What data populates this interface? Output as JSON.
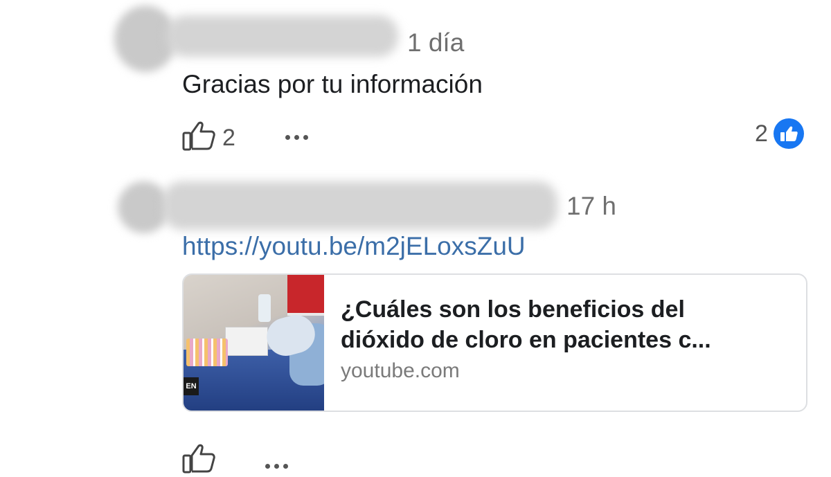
{
  "comments": [
    {
      "timestamp": "1 día",
      "text": "Gracias por tu información",
      "like_count": "2",
      "reaction_count": "2",
      "reaction_icon": "like-reaction-icon"
    },
    {
      "timestamp": "17 h",
      "link": "https://youtu.be/m2jELoxsZuU",
      "preview": {
        "title_line1": "¿Cuáles son los beneficios del",
        "title_line2": "dióxido de cloro en pacientes c...",
        "domain": "youtube.com",
        "thumb_brand_text": "EN"
      }
    }
  ],
  "colors": {
    "link": "#3b6ea8",
    "reaction_badge": "#1877f2",
    "secondary_text": "#6f6f6f"
  }
}
